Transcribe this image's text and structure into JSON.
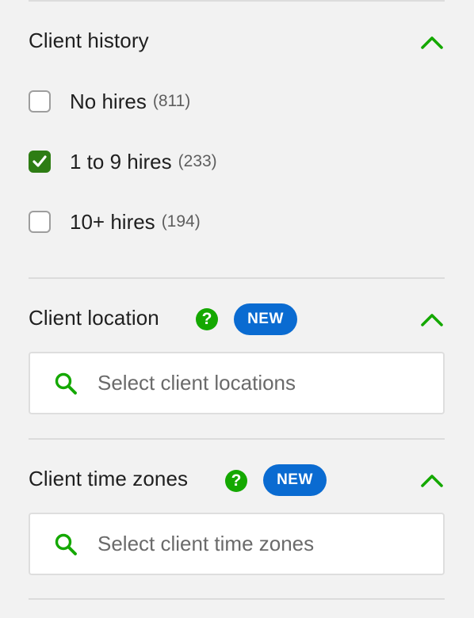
{
  "sections": {
    "client_history": {
      "title": "Client history",
      "options": [
        {
          "label": "No hires",
          "count": "(811)",
          "checked": false
        },
        {
          "label": "1 to 9 hires",
          "count": "(233)",
          "checked": true
        },
        {
          "label": "10+ hires",
          "count": "(194)",
          "checked": false
        }
      ]
    },
    "client_location": {
      "title": "Client location",
      "help": "?",
      "badge": "NEW",
      "search_placeholder": "Select client locations"
    },
    "client_time_zones": {
      "title": "Client time zones",
      "help": "?",
      "badge": "NEW",
      "search_placeholder": "Select client time zones"
    }
  },
  "colors": {
    "accent_green": "#14a800",
    "checkbox_green": "#2e7d14",
    "badge_blue": "#0a6bd1",
    "background": "#f2f2f2"
  },
  "icons": [
    "chevron-up-icon",
    "checkmark-icon",
    "help-icon",
    "search-icon"
  ]
}
